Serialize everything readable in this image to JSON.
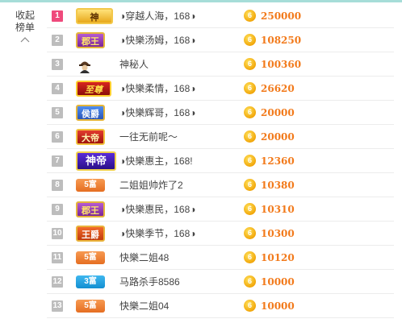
{
  "panel": {
    "collapse_label_line1": "收起",
    "collapse_label_line2": "榜单"
  },
  "coin_glyph": "6",
  "colors": {
    "accent_bar": "#a6ddd8",
    "score": "#f27a1b",
    "rank_first": "#ef4a7c",
    "rank_default": "#bdbdbd",
    "coin": "#f2a70a"
  },
  "rows": [
    {
      "rank": "1",
      "badge": "神",
      "badge_type": "shen",
      "name": "◑穿越人海，168◑",
      "score": "250000"
    },
    {
      "rank": "2",
      "badge": "郡王",
      "badge_type": "junwang",
      "name": "◑快樂汤姆，168◑",
      "score": "108250"
    },
    {
      "rank": "3",
      "badge": "",
      "badge_type": "shenmi",
      "name": "神秘人",
      "score": "100360"
    },
    {
      "rank": "4",
      "badge": "至尊",
      "badge_type": "zhizun",
      "name": "◑快樂柔情，168◑",
      "score": "26620"
    },
    {
      "rank": "5",
      "badge": "侯爵",
      "badge_type": "houjue",
      "name": "◑快樂辉哥，168◑",
      "score": "20000"
    },
    {
      "rank": "6",
      "badge": "大帝",
      "badge_type": "dadi",
      "name": "一往无前呢～",
      "score": "20000"
    },
    {
      "rank": "7",
      "badge": "神帝",
      "badge_type": "shendi",
      "name": "◑快樂惠主，168!",
      "score": "12360"
    },
    {
      "rank": "8",
      "badge": "5富",
      "badge_type": "fu5",
      "name": "二姐姐帅炸了2",
      "score": "10380"
    },
    {
      "rank": "9",
      "badge": "郡王",
      "badge_type": "junwang",
      "name": "◑快樂惠民，168◑",
      "score": "10310"
    },
    {
      "rank": "10",
      "badge": "王爵",
      "badge_type": "wangjue",
      "name": "◑快樂季节，168◑",
      "score": "10300"
    },
    {
      "rank": "11",
      "badge": "5富",
      "badge_type": "fu5",
      "name": "快樂二姐48",
      "score": "10120"
    },
    {
      "rank": "12",
      "badge": "3富",
      "badge_type": "fu3",
      "name": "马路杀手8586",
      "score": "10000"
    },
    {
      "rank": "13",
      "badge": "5富",
      "badge_type": "fu5",
      "name": "快樂二姐04",
      "score": "10000"
    }
  ]
}
